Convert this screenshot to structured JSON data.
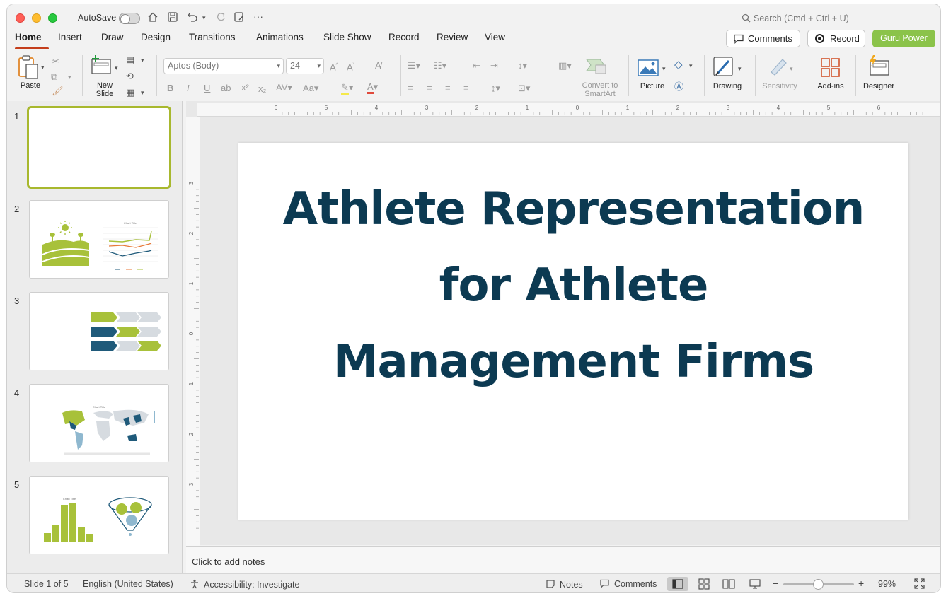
{
  "titlebar": {
    "autosave_label": "AutoSave",
    "search_placeholder": "Search (Cmd + Ctrl + U)"
  },
  "tabs": [
    {
      "label": "Home",
      "active": true
    },
    {
      "label": "Insert"
    },
    {
      "label": "Draw"
    },
    {
      "label": "Design"
    },
    {
      "label": "Transitions"
    },
    {
      "label": "Animations"
    },
    {
      "label": "Slide Show"
    },
    {
      "label": "Record"
    },
    {
      "label": "Review"
    },
    {
      "label": "View"
    }
  ],
  "header_buttons": {
    "comments": "Comments",
    "record": "Record",
    "guru": "Guru Power"
  },
  "ribbon": {
    "paste": "Paste",
    "new_slide": "New\nSlide",
    "font_name": "Aptos (Body)",
    "font_size": "24",
    "convert_smartart": "Convert to\nSmartArt",
    "picture": "Picture",
    "drawing": "Drawing",
    "sensitivity": "Sensitivity",
    "addins": "Add-ins",
    "designer": "Designer"
  },
  "slides": [
    {
      "number": "1"
    },
    {
      "number": "2"
    },
    {
      "number": "3"
    },
    {
      "number": "4"
    },
    {
      "number": "5"
    }
  ],
  "thumb_text": {
    "chart_title": "Chart Title"
  },
  "current_slide": {
    "title": "Athlete Representation for Athlete Management Firms"
  },
  "notes": {
    "placeholder": "Click to add notes"
  },
  "status": {
    "slide_indicator": "Slide 1 of 5",
    "language": "English (United States)",
    "accessibility": "Accessibility: Investigate",
    "notes": "Notes",
    "comments": "Comments",
    "zoom_minus": "−",
    "zoom_plus": "+",
    "zoom": "99%"
  },
  "ruler": {
    "h_ticks": [
      "6",
      "5",
      "4",
      "3",
      "2",
      "1",
      "0",
      "1",
      "2",
      "3",
      "4",
      "5",
      "6"
    ],
    "v_ticks": [
      "3",
      "2",
      "1",
      "0",
      "1",
      "2",
      "3"
    ]
  },
  "colors": {
    "brand_tab": "#c43e1c",
    "guru_green": "#8bc34a",
    "title_navy": "#0c3a52",
    "thumb_green": "#a8c13a",
    "thumb_navy": "#1f5a7a"
  }
}
